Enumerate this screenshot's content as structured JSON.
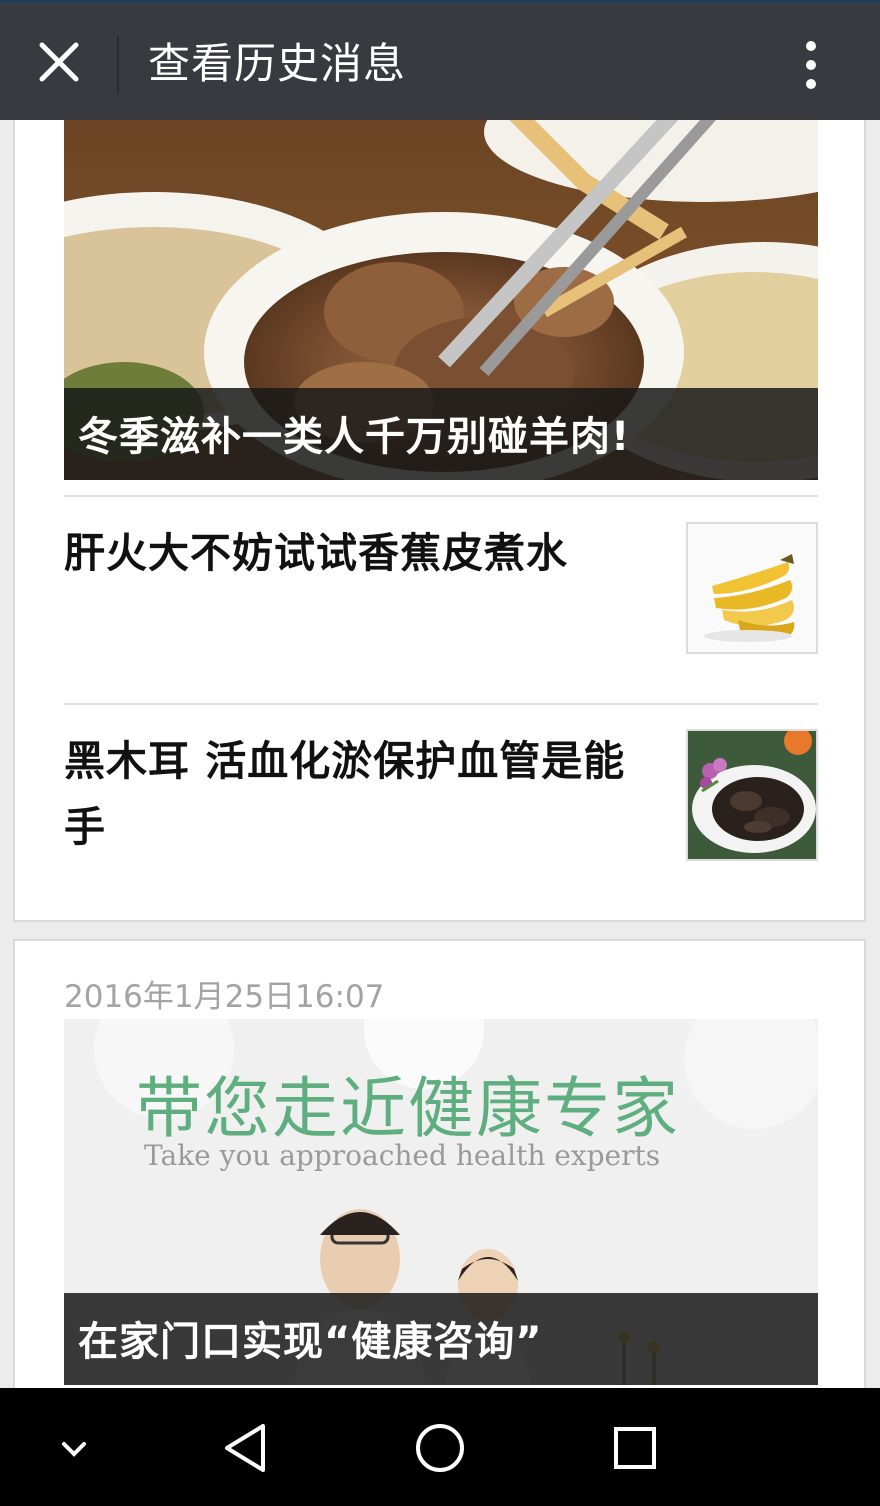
{
  "header": {
    "title": "查看历史消息",
    "close_icon": "close-icon",
    "more_icon": "more-vertical-icon"
  },
  "card1": {
    "cover_title": "冬季滋补一类人千万别碰羊肉!",
    "items": [
      {
        "title": "肝火大不妨试试香蕉皮煮水",
        "thumb_icon": "banana-image"
      },
      {
        "title": "黑木耳 活血化淤保护血管是能手",
        "thumb_icon": "black-fungus-image"
      }
    ]
  },
  "card2": {
    "date": "2016年1月25日16:07",
    "banner_heading": "带您走近健康专家",
    "banner_subheading": "Take you approached health experts",
    "cover_title": "在家门口实现“健康咨询”"
  },
  "navbar": {
    "icons": [
      "chevron-down-icon",
      "back-triangle-icon",
      "home-circle-icon",
      "recents-square-icon"
    ]
  },
  "colors": {
    "header_bg": "#393a3f",
    "caption_bg": "#191919",
    "date_text": "#a3a3a3",
    "banner_green": "#5fae7f"
  }
}
